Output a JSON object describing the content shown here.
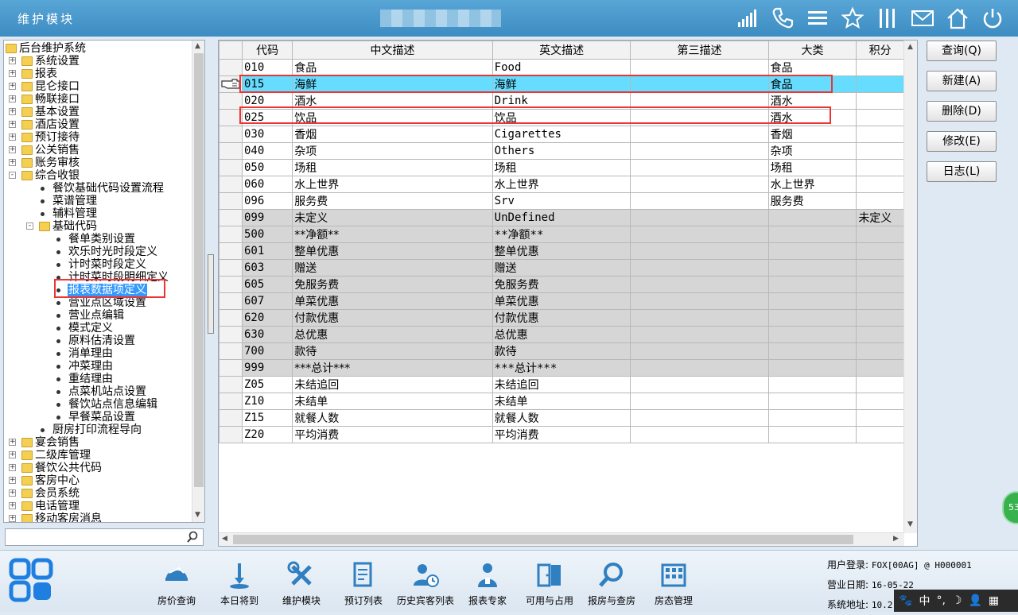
{
  "app": {
    "title": "维护模块"
  },
  "tree": {
    "nodes": [
      {
        "label": "后台维护系统",
        "level": 0,
        "kind": "folder",
        "expander": ""
      },
      {
        "label": "系统设置",
        "level": 1,
        "kind": "folder",
        "expander": "+"
      },
      {
        "label": "报表",
        "level": 1,
        "kind": "folder",
        "expander": "+"
      },
      {
        "label": "昆仑接口",
        "level": 1,
        "kind": "folder",
        "expander": "+"
      },
      {
        "label": "畅联接口",
        "level": 1,
        "kind": "folder",
        "expander": "+"
      },
      {
        "label": "基本设置",
        "level": 1,
        "kind": "folder",
        "expander": "+"
      },
      {
        "label": "酒店设置",
        "level": 1,
        "kind": "folder",
        "expander": "+"
      },
      {
        "label": "预订接待",
        "level": 1,
        "kind": "folder",
        "expander": "+"
      },
      {
        "label": "公关销售",
        "level": 1,
        "kind": "folder",
        "expander": "+"
      },
      {
        "label": "账务审核",
        "level": 1,
        "kind": "folder",
        "expander": "+"
      },
      {
        "label": "综合收银",
        "level": 1,
        "kind": "folder",
        "expander": "-"
      },
      {
        "label": "餐饮基础代码设置流程",
        "level": 2,
        "kind": "leaf",
        "expander": ""
      },
      {
        "label": "菜谱管理",
        "level": 2,
        "kind": "leaf",
        "expander": ""
      },
      {
        "label": "辅料管理",
        "level": 2,
        "kind": "leaf",
        "expander": ""
      },
      {
        "label": "基础代码",
        "level": 2,
        "kind": "folder",
        "expander": "-"
      },
      {
        "label": "餐单类别设置",
        "level": 3,
        "kind": "leaf",
        "expander": ""
      },
      {
        "label": "欢乐时光时段定义",
        "level": 3,
        "kind": "leaf",
        "expander": ""
      },
      {
        "label": "计时菜时段定义",
        "level": 3,
        "kind": "leaf",
        "expander": ""
      },
      {
        "label": "计时菜时段明细定义",
        "level": 3,
        "kind": "leaf",
        "expander": ""
      },
      {
        "label": "报表数据项定义",
        "level": 3,
        "kind": "leaf",
        "expander": "",
        "selected": true
      },
      {
        "label": "营业点区域设置",
        "level": 3,
        "kind": "leaf",
        "expander": ""
      },
      {
        "label": "营业点编辑",
        "level": 3,
        "kind": "leaf",
        "expander": ""
      },
      {
        "label": "模式定义",
        "level": 3,
        "kind": "leaf",
        "expander": ""
      },
      {
        "label": "原料估清设置",
        "level": 3,
        "kind": "leaf",
        "expander": ""
      },
      {
        "label": "消单理由",
        "level": 3,
        "kind": "leaf",
        "expander": ""
      },
      {
        "label": "冲菜理由",
        "level": 3,
        "kind": "leaf",
        "expander": ""
      },
      {
        "label": "重结理由",
        "level": 3,
        "kind": "leaf",
        "expander": ""
      },
      {
        "label": "点菜机站点设置",
        "level": 3,
        "kind": "leaf",
        "expander": ""
      },
      {
        "label": "餐饮站点信息编辑",
        "level": 3,
        "kind": "leaf",
        "expander": ""
      },
      {
        "label": "早餐菜品设置",
        "level": 3,
        "kind": "leaf",
        "expander": ""
      },
      {
        "label": "厨房打印流程导向",
        "level": 2,
        "kind": "leaf",
        "expander": ""
      },
      {
        "label": "宴会销售",
        "level": 1,
        "kind": "folder",
        "expander": "+"
      },
      {
        "label": "二级库管理",
        "level": 1,
        "kind": "folder",
        "expander": "+"
      },
      {
        "label": "餐饮公共代码",
        "level": 1,
        "kind": "folder",
        "expander": "+"
      },
      {
        "label": "客房中心",
        "level": 1,
        "kind": "folder",
        "expander": "+"
      },
      {
        "label": "会员系统",
        "level": 1,
        "kind": "folder",
        "expander": "+"
      },
      {
        "label": "电话管理",
        "level": 1,
        "kind": "folder",
        "expander": "+"
      },
      {
        "label": "移动客房消息",
        "level": 1,
        "kind": "folder",
        "expander": "+"
      }
    ],
    "search": {
      "value": ""
    }
  },
  "grid": {
    "columns": [
      "代码",
      "中文描述",
      "英文描述",
      "第三描述",
      "大类",
      "积分"
    ],
    "rows": [
      {
        "code": "010",
        "cn": "食品",
        "en": "Food",
        "third": "",
        "cat": "食品",
        "extra": "",
        "style": "white"
      },
      {
        "code": "015",
        "cn": "海鲜",
        "en": "海鲜",
        "third": "",
        "cat": "食品",
        "extra": "",
        "style": "selected"
      },
      {
        "code": "020",
        "cn": "酒水",
        "en": "Drink",
        "third": "",
        "cat": "酒水",
        "extra": "",
        "style": "white"
      },
      {
        "code": "025",
        "cn": "饮品",
        "en": "饮品",
        "third": "",
        "cat": "酒水",
        "extra": "",
        "style": "white"
      },
      {
        "code": "030",
        "cn": "香烟",
        "en": "Cigarettes",
        "third": "",
        "cat": "香烟",
        "extra": "",
        "style": "white"
      },
      {
        "code": "040",
        "cn": "杂项",
        "en": "Others",
        "third": "",
        "cat": "杂项",
        "extra": "",
        "style": "white"
      },
      {
        "code": "050",
        "cn": "场租",
        "en": "场租",
        "third": "",
        "cat": "场租",
        "extra": "",
        "style": "white"
      },
      {
        "code": "060",
        "cn": "水上世界",
        "en": "水上世界",
        "third": "",
        "cat": "水上世界",
        "extra": "",
        "style": "white"
      },
      {
        "code": "096",
        "cn": "服务费",
        "en": "Srv",
        "third": "",
        "cat": "服务费",
        "extra": "",
        "style": "white"
      },
      {
        "code": "099",
        "cn": "未定义",
        "en": "UnDefined",
        "third": "",
        "cat": "",
        "extra": "未定义",
        "style": "gray"
      },
      {
        "code": "500",
        "cn": "**净额**",
        "en": "**净额**",
        "third": "",
        "cat": "",
        "extra": "",
        "style": "gray"
      },
      {
        "code": "601",
        "cn": "整单优惠",
        "en": "整单优惠",
        "third": "",
        "cat": "",
        "extra": "",
        "style": "gray"
      },
      {
        "code": "603",
        "cn": "赠送",
        "en": "赠送",
        "third": "",
        "cat": "",
        "extra": "",
        "style": "gray"
      },
      {
        "code": "605",
        "cn": "免服务费",
        "en": "免服务费",
        "third": "",
        "cat": "",
        "extra": "",
        "style": "gray"
      },
      {
        "code": "607",
        "cn": "单菜优惠",
        "en": "单菜优惠",
        "third": "",
        "cat": "",
        "extra": "",
        "style": "gray"
      },
      {
        "code": "620",
        "cn": "付款优惠",
        "en": "付款优惠",
        "third": "",
        "cat": "",
        "extra": "",
        "style": "gray"
      },
      {
        "code": "630",
        "cn": "总优惠",
        "en": "总优惠",
        "third": "",
        "cat": "",
        "extra": "",
        "style": "gray"
      },
      {
        "code": "700",
        "cn": "款待",
        "en": "款待",
        "third": "",
        "cat": "",
        "extra": "",
        "style": "gray"
      },
      {
        "code": "999",
        "cn": "***总计***",
        "en": "***总计***",
        "third": "",
        "cat": "",
        "extra": "",
        "style": "gray"
      },
      {
        "code": "Z05",
        "cn": "未结追回",
        "en": "未结追回",
        "third": "",
        "cat": "",
        "extra": "",
        "style": "white"
      },
      {
        "code": "Z10",
        "cn": "未结单",
        "en": "未结单",
        "third": "",
        "cat": "",
        "extra": "",
        "style": "white"
      },
      {
        "code": "Z15",
        "cn": "就餐人数",
        "en": "就餐人数",
        "third": "",
        "cat": "",
        "extra": "",
        "style": "white"
      },
      {
        "code": "Z20",
        "cn": "平均消费",
        "en": "平均消费",
        "third": "",
        "cat": "",
        "extra": "",
        "style": "white"
      }
    ]
  },
  "buttons": [
    {
      "label": "查询(Q)",
      "name": "query-button"
    },
    {
      "label": "新建(A)",
      "name": "new-button"
    },
    {
      "label": "删除(D)",
      "name": "delete-button"
    },
    {
      "label": "修改(E)",
      "name": "edit-button"
    },
    {
      "label": "日志(L)",
      "name": "log-button"
    }
  ],
  "badge": {
    "text": "53"
  },
  "taskbar": {
    "items": [
      {
        "label": "房价查询",
        "icon": "room-rate-icon"
      },
      {
        "label": "本日将到",
        "icon": "arrival-pin-icon"
      },
      {
        "label": "维护模块",
        "icon": "wrench-icon"
      },
      {
        "label": "预订列表",
        "icon": "booking-list-icon"
      },
      {
        "label": "历史宾客列表",
        "icon": "guest-history-icon"
      },
      {
        "label": "报表专家",
        "icon": "report-expert-icon"
      },
      {
        "label": "可用与占用",
        "icon": "door-icon"
      },
      {
        "label": "报房与查房",
        "icon": "magnifier-icon"
      },
      {
        "label": "房态管理",
        "icon": "room-status-icon"
      }
    ]
  },
  "sysinfo": {
    "user_label": "用户登录:",
    "user_value": "FOX[00AG] @ H000001",
    "date_label": "营业日期:",
    "date_value": "16-05-22",
    "addr_label": "系统地址:",
    "addr_value": "10.2"
  },
  "ime": {
    "lang": "中",
    "punct": "°,"
  },
  "colors": {
    "titlebar": "#4a9bcf",
    "selected_row": "#66ddff",
    "tree_selected": "#3399ff",
    "highlight_box": "#ee3333"
  }
}
